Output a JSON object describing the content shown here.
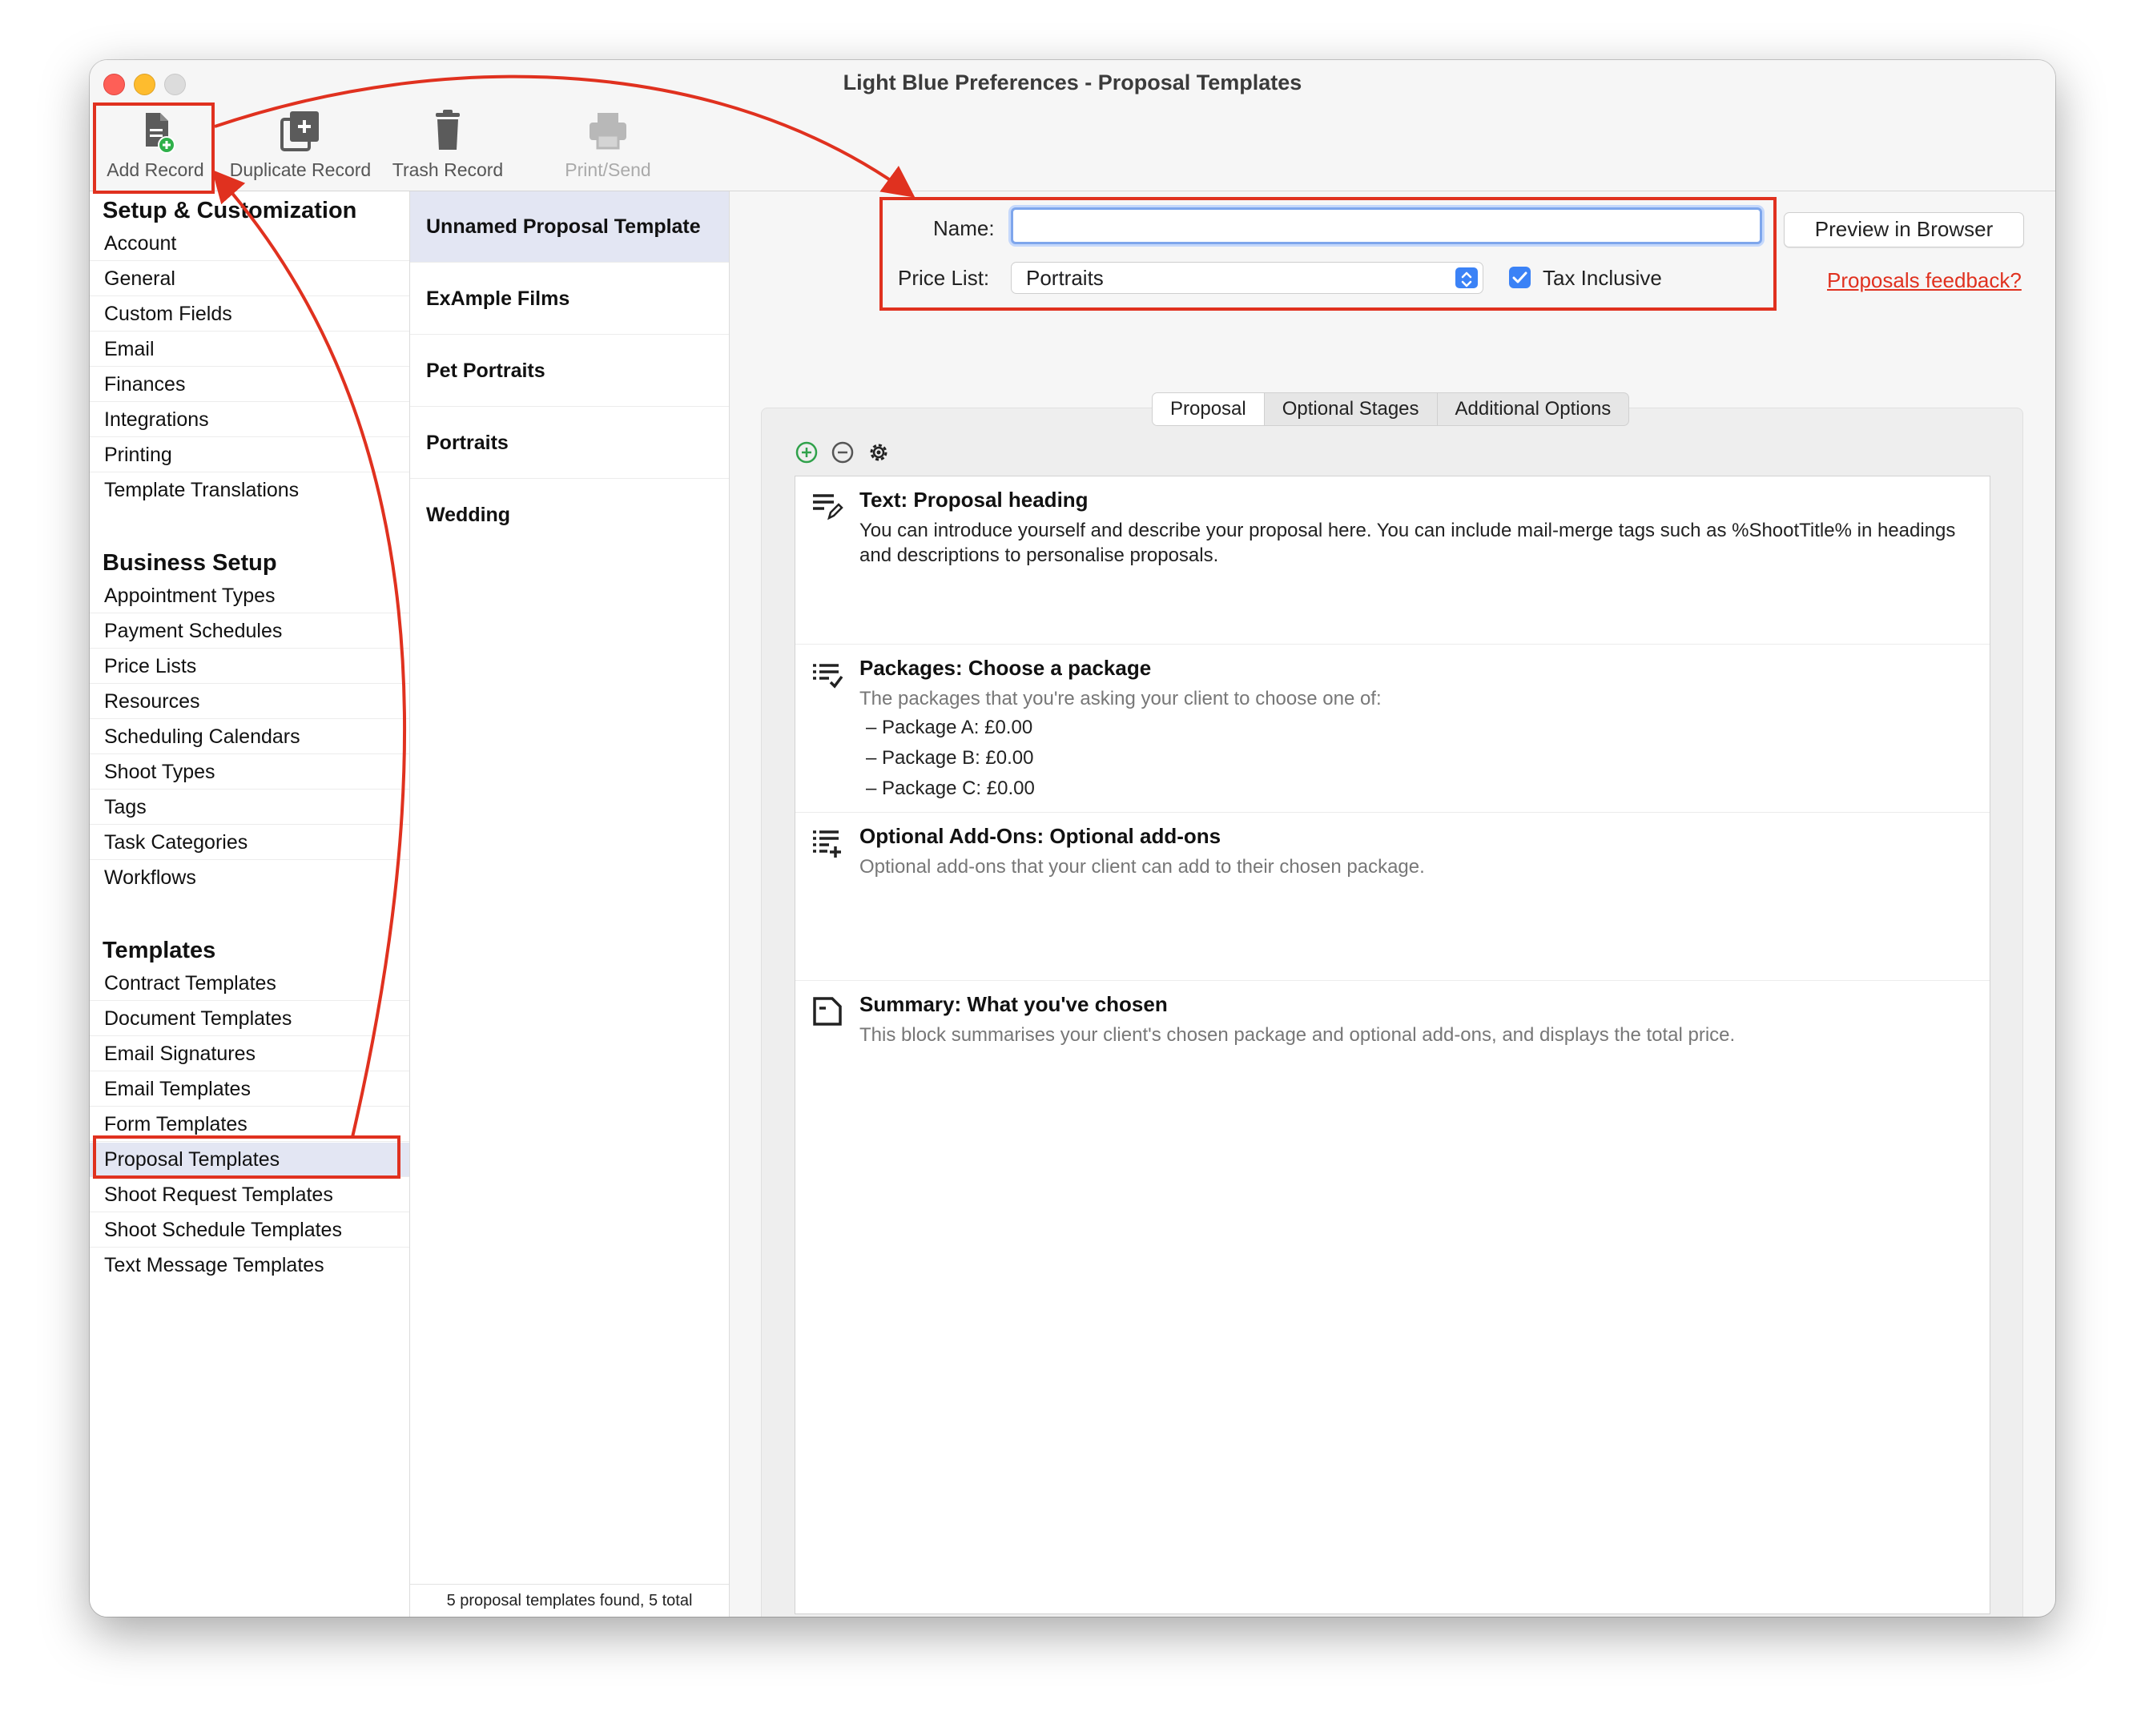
{
  "window": {
    "title": "Light Blue Preferences - Proposal Templates"
  },
  "toolbar": {
    "add_record": "Add Record",
    "duplicate_record": "Duplicate Record",
    "trash_record": "Trash Record",
    "print_send": "Print/Send"
  },
  "sidebar": {
    "sections": [
      {
        "title": "Setup & Customization",
        "items": [
          "Account",
          "General",
          "Custom Fields",
          "Email",
          "Finances",
          "Integrations",
          "Printing",
          "Template Translations"
        ]
      },
      {
        "title": "Business Setup",
        "items": [
          "Appointment Types",
          "Payment Schedules",
          "Price Lists",
          "Resources",
          "Scheduling Calendars",
          "Shoot Types",
          "Tags",
          "Task Categories",
          "Workflows"
        ]
      },
      {
        "title": "Templates",
        "items": [
          "Contract Templates",
          "Document Templates",
          "Email Signatures",
          "Email Templates",
          "Form Templates",
          "Proposal Templates",
          "Shoot Request Templates",
          "Shoot Schedule Templates",
          "Text Message Templates"
        ]
      }
    ],
    "selected": "Proposal Templates"
  },
  "records": {
    "items": [
      "Unnamed Proposal Template",
      "ExAmple Films",
      "Pet Portraits",
      "Portraits",
      "Wedding"
    ],
    "selected": "Unnamed Proposal Template",
    "status": "5 proposal templates found, 5 total"
  },
  "form": {
    "name_label": "Name:",
    "name_value": "",
    "price_list_label": "Price List:",
    "price_list_value": "Portraits",
    "tax_inclusive_label": "Tax Inclusive",
    "tax_inclusive_checked": true,
    "preview_button": "Preview in Browser",
    "feedback_link": "Proposals feedback?"
  },
  "tabs": {
    "items": [
      "Proposal",
      "Optional Stages",
      "Additional Options"
    ],
    "active": "Proposal"
  },
  "blocks": [
    {
      "title": "Text: Proposal heading",
      "description": "You can introduce yourself and describe your proposal here. You can include mail-merge tags such as %ShootTitle% in headings and descriptions to personalise proposals.",
      "icon": "text-edit-icon"
    },
    {
      "title": "Packages: Choose a package",
      "description": "The packages that you're asking your client to choose one of:",
      "packages": [
        "– Package A: £0.00",
        "– Package B: £0.00",
        "– Package C: £0.00"
      ],
      "icon": "list-check-icon"
    },
    {
      "title": "Optional Add-Ons: Optional add-ons",
      "description": "Optional add-ons that your client can add to their chosen package.",
      "icon": "list-add-icon"
    },
    {
      "title": "Summary: What you've chosen",
      "description": "This block summarises your client's chosen package and optional add-ons, and displays the total price.",
      "icon": "document-icon"
    }
  ],
  "colors": {
    "annotation_red": "#e0311f",
    "accent_blue": "#3b82f6",
    "selection": "#e3e6f3"
  }
}
